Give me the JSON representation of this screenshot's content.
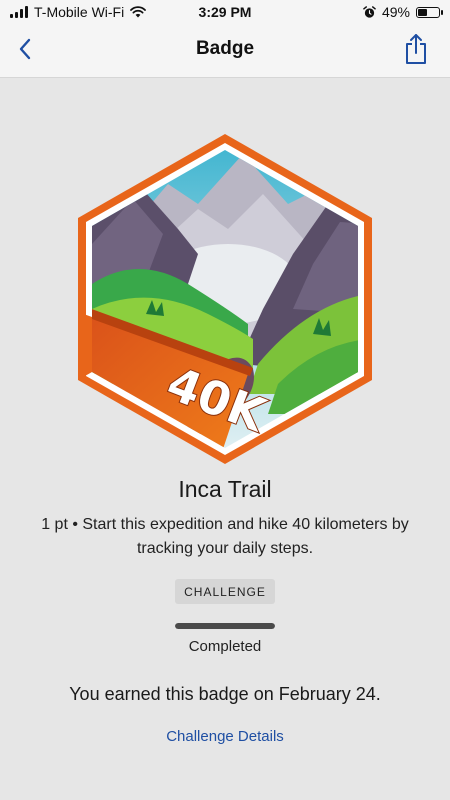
{
  "status_bar": {
    "carrier": "T-Mobile Wi-Fi",
    "time": "3:29 PM",
    "battery_text": "49%",
    "battery_level": 0.49
  },
  "nav": {
    "title": "Badge",
    "back_icon": "chevron-left-icon",
    "share_icon": "share-icon"
  },
  "badge": {
    "artwork_text": "40K",
    "name": "Inca Trail",
    "description": "1 pt • Start this expedition and hike 40 kilometers by tracking your daily steps.",
    "category_chip": "CHALLENGE",
    "progress": 1.0,
    "progress_label": "Completed",
    "earned_text": "You earned this badge on February 24.",
    "details_link": "Challenge Details"
  },
  "colors": {
    "accent_link": "#1f4fa3",
    "badge_orange": "#e8651a",
    "background": "#e6e6e6"
  }
}
